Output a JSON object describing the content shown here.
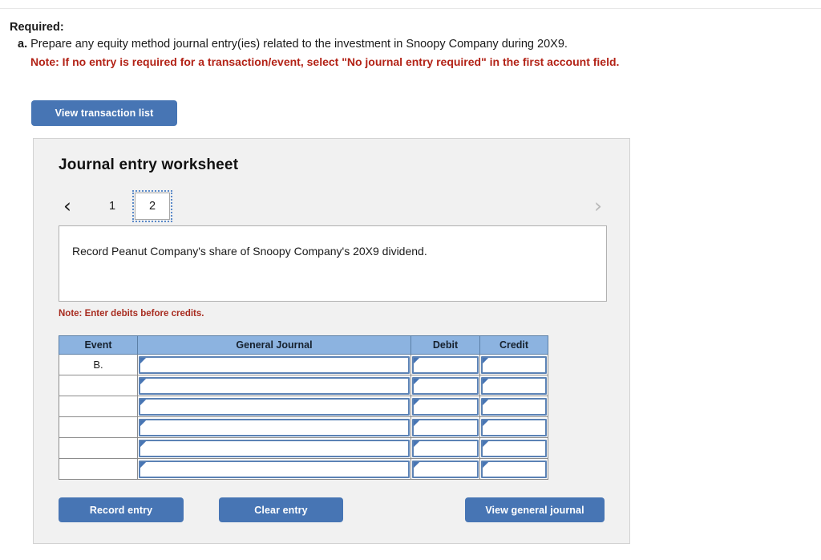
{
  "required": {
    "heading": "Required:",
    "item_label": "a.",
    "item_text": "Prepare any equity method journal entry(ies) related to the investment in Snoopy Company during 20X9.",
    "note": "Note: If no entry is required for a transaction/event, select \"No journal entry required\" in the first account field."
  },
  "toolbar": {
    "view_transaction_list_label": "View transaction list"
  },
  "worksheet": {
    "title": "Journal entry worksheet",
    "pager": {
      "prev_icon": "chevron-left-icon",
      "prev_glyph": "‹",
      "next_icon": "chevron-right-icon",
      "next_glyph": "›",
      "tabs": [
        {
          "label": "1",
          "selected": false
        },
        {
          "label": "2",
          "selected": true
        }
      ]
    },
    "description": "Record Peanut Company's share of Snoopy Company's 20X9 dividend.",
    "debits_note": "Note: Enter debits before credits.",
    "table": {
      "columns": [
        "Event",
        "General Journal",
        "Debit",
        "Credit"
      ],
      "rows": [
        {
          "event": "B.",
          "general_journal": "",
          "debit": "",
          "credit": ""
        },
        {
          "event": "",
          "general_journal": "",
          "debit": "",
          "credit": ""
        },
        {
          "event": "",
          "general_journal": "",
          "debit": "",
          "credit": ""
        },
        {
          "event": "",
          "general_journal": "",
          "debit": "",
          "credit": ""
        },
        {
          "event": "",
          "general_journal": "",
          "debit": "",
          "credit": ""
        },
        {
          "event": "",
          "general_journal": "",
          "debit": "",
          "credit": ""
        }
      ]
    },
    "actions": {
      "record_entry_label": "Record entry",
      "clear_entry_label": "Clear entry",
      "view_general_journal_label": "View general journal"
    }
  },
  "colors": {
    "button_blue": "#4775b4",
    "table_header_blue": "#8cb3e0",
    "note_red": "#b32317",
    "panel_gray": "#f1f1f1"
  }
}
